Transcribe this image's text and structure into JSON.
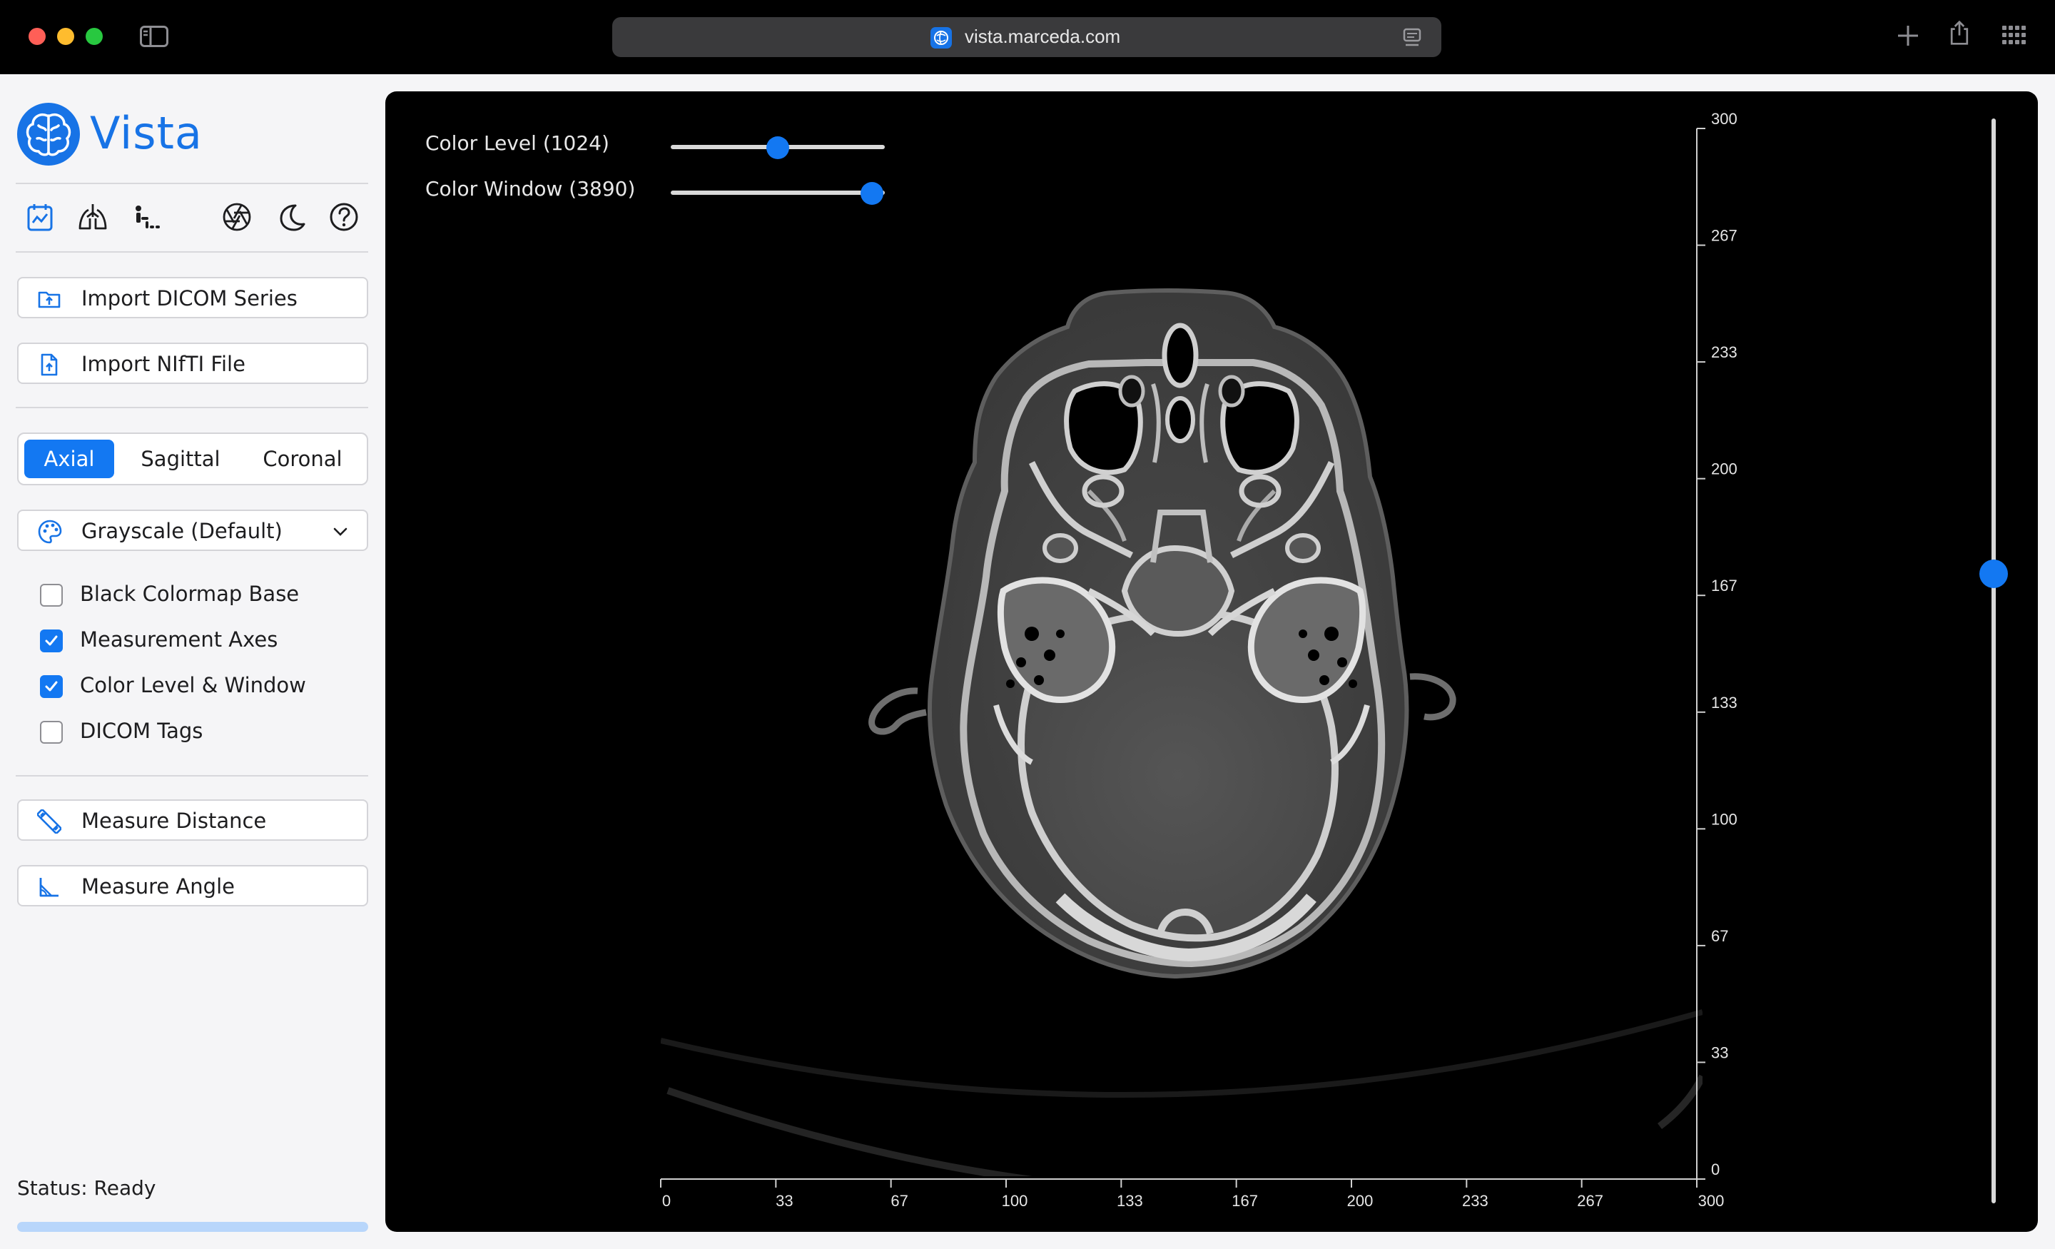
{
  "browser": {
    "url": "vista.marceda.com"
  },
  "app": {
    "brand": "Vista",
    "icons": [
      "brain-logo-icon",
      "chart-icon",
      "lungs-icon",
      "skeleton-icon",
      "aperture-icon",
      "moon-icon",
      "help-icon"
    ]
  },
  "sidebar": {
    "import_dicom": "Import DICOM Series",
    "import_nifti": "Import NIfTI File",
    "views": [
      {
        "label": "Axial",
        "active": true
      },
      {
        "label": "Sagittal",
        "active": false
      },
      {
        "label": "Coronal",
        "active": false
      }
    ],
    "colormap": "Grayscale (Default)",
    "options": [
      {
        "label": "Black Colormap Base",
        "checked": false
      },
      {
        "label": "Measurement Axes",
        "checked": true
      },
      {
        "label": "Color Level & Window",
        "checked": true
      },
      {
        "label": "DICOM Tags",
        "checked": false
      }
    ],
    "measure_distance": "Measure Distance",
    "measure_angle": "Measure Angle",
    "status": "Status: Ready",
    "progress_fraction": 1.0
  },
  "viewer": {
    "color_level_label": "Color Level (1024)",
    "color_level_fraction": 0.5,
    "color_window_label": "Color Window (3890)",
    "color_window_fraction": 0.94,
    "slice_fraction": 0.42,
    "x_ticks": [
      "0",
      "33",
      "67",
      "100",
      "133",
      "167",
      "200",
      "233",
      "267",
      "300"
    ],
    "y_ticks": [
      "0",
      "33",
      "67",
      "100",
      "133",
      "167",
      "200",
      "233",
      "267",
      "300"
    ]
  },
  "colors": {
    "accent": "#1378f2",
    "brand": "#1773e6",
    "viewer_bg": "#000000"
  }
}
